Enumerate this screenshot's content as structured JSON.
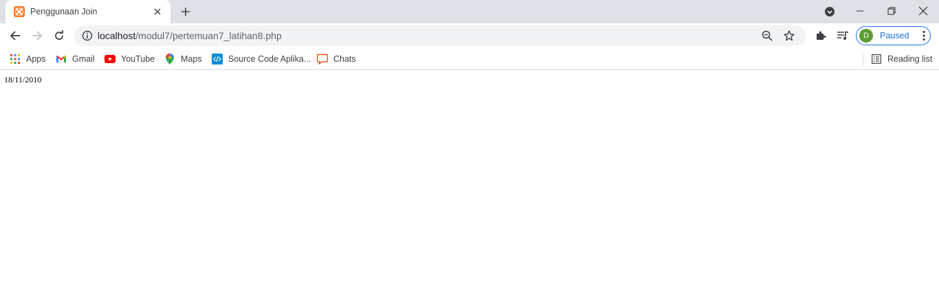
{
  "tab": {
    "title": "Penggunaan Join",
    "favicon_color": "#fb7a24"
  },
  "window_controls": {
    "minimize": "minimize-icon",
    "restore": "restore-icon",
    "close": "close-icon"
  },
  "toolbar": {
    "url_host": "localhost",
    "url_path": "/modul7/pertemuan7_latihan8.php",
    "profile_initial": "D",
    "profile_status": "Paused",
    "accent_color": "#1a73e8"
  },
  "bookmarks": {
    "items": [
      {
        "label": "Apps",
        "icon": "apps-grid-icon"
      },
      {
        "label": "Gmail",
        "icon": "gmail-icon"
      },
      {
        "label": "YouTube",
        "icon": "youtube-icon"
      },
      {
        "label": "Maps",
        "icon": "maps-pin-icon"
      },
      {
        "label": "Source Code Aplika...",
        "icon": "code-icon"
      },
      {
        "label": "Chats",
        "icon": "chat-icon"
      }
    ],
    "reading_list": "Reading list"
  },
  "page": {
    "date_text": "18/11/2010"
  }
}
